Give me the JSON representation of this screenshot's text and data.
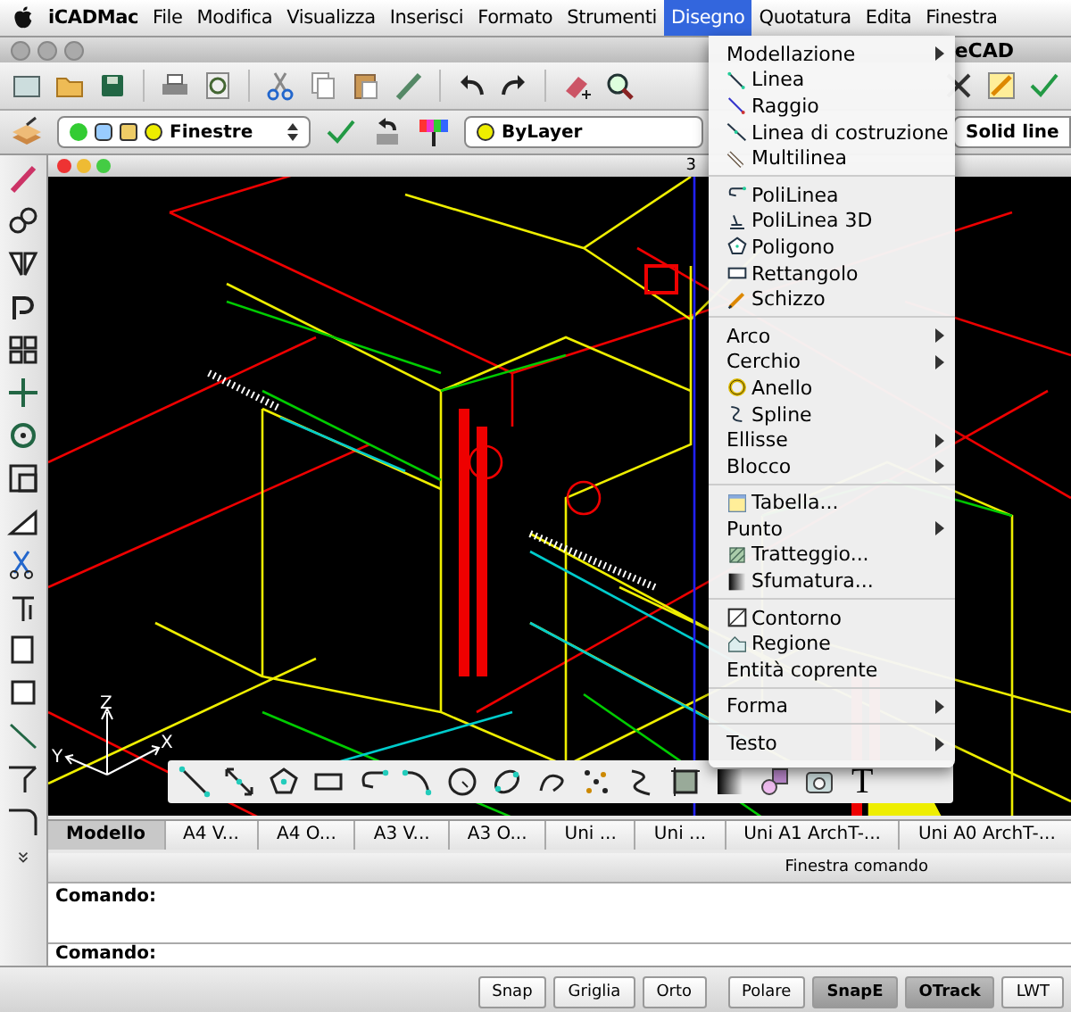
{
  "menubar": {
    "app_name": "iCADMac",
    "items": [
      {
        "label": "File",
        "selected": false
      },
      {
        "label": "Modifica",
        "selected": false
      },
      {
        "label": "Visualizza",
        "selected": false
      },
      {
        "label": "Inserisci",
        "selected": false
      },
      {
        "label": "Formato",
        "selected": false
      },
      {
        "label": "Strumenti",
        "selected": false
      },
      {
        "label": "Disegno",
        "selected": true
      },
      {
        "label": "Quotatura",
        "selected": false
      },
      {
        "label": "Edita",
        "selected": false
      },
      {
        "label": "Finestra",
        "selected": false
      }
    ]
  },
  "window": {
    "title_fragment": "eCAD"
  },
  "properties_toolbar": {
    "layer": "Finestre",
    "color_setting": "ByLayer",
    "linetype": "Solid line"
  },
  "drawing_window": {
    "title_fragment": "3",
    "axis_labels": [
      "Z",
      "Y",
      "X"
    ]
  },
  "floating_toolbar": {
    "text_tool": "T"
  },
  "layout_tabs": [
    {
      "label": "Modello",
      "selected": true
    },
    {
      "label": "A4 V...",
      "selected": false
    },
    {
      "label": "A4 O...",
      "selected": false
    },
    {
      "label": "A3 V...",
      "selected": false
    },
    {
      "label": "A3 O...",
      "selected": false
    },
    {
      "label": "Uni ...",
      "selected": false
    },
    {
      "label": "Uni ...",
      "selected": false
    },
    {
      "label": "Uni A1 ArchT-...",
      "selected": false
    },
    {
      "label": "Uni A0 ArchT-...",
      "selected": false
    }
  ],
  "command_window": {
    "title": "Finestra comando",
    "history_prompt": "Comando:",
    "prompt": "Comando:"
  },
  "status_buttons": [
    {
      "label": "Snap",
      "on": false
    },
    {
      "label": "Griglia",
      "on": false
    },
    {
      "label": "Orto",
      "on": false
    },
    {
      "label": "Polare",
      "on": false
    },
    {
      "label": "SnapE",
      "on": true
    },
    {
      "label": "OTrack",
      "on": true
    },
    {
      "label": "LWT",
      "on": false
    }
  ],
  "menu": {
    "groups": [
      [
        {
          "label": "Modellazione",
          "submenu": true
        },
        {
          "label": "Linea",
          "submenu": false
        },
        {
          "label": "Raggio",
          "submenu": false
        },
        {
          "label": "Linea di costruzione",
          "submenu": false
        },
        {
          "label": "Multilinea",
          "submenu": false
        }
      ],
      [
        {
          "label": "PoliLinea",
          "submenu": false
        },
        {
          "label": "PoliLinea 3D",
          "submenu": false
        },
        {
          "label": "Poligono",
          "submenu": false
        },
        {
          "label": "Rettangolo",
          "submenu": false
        },
        {
          "label": "Schizzo",
          "submenu": false
        }
      ],
      [
        {
          "label": "Arco",
          "submenu": true
        },
        {
          "label": "Cerchio",
          "submenu": true
        },
        {
          "label": "Anello",
          "submenu": false
        },
        {
          "label": "Spline",
          "submenu": false
        },
        {
          "label": "Ellisse",
          "submenu": true
        },
        {
          "label": "Blocco",
          "submenu": true
        }
      ],
      [
        {
          "label": "Tabella...",
          "submenu": false
        },
        {
          "label": "Punto",
          "submenu": true
        },
        {
          "label": "Tratteggio...",
          "submenu": false
        },
        {
          "label": "Sfumatura...",
          "submenu": false
        }
      ],
      [
        {
          "label": "Contorno",
          "submenu": false
        },
        {
          "label": "Regione",
          "submenu": false
        },
        {
          "label": "Entità coprente",
          "submenu": false
        }
      ],
      [
        {
          "label": "Forma",
          "submenu": true
        }
      ],
      [
        {
          "label": "Testo",
          "submenu": true
        }
      ]
    ]
  }
}
